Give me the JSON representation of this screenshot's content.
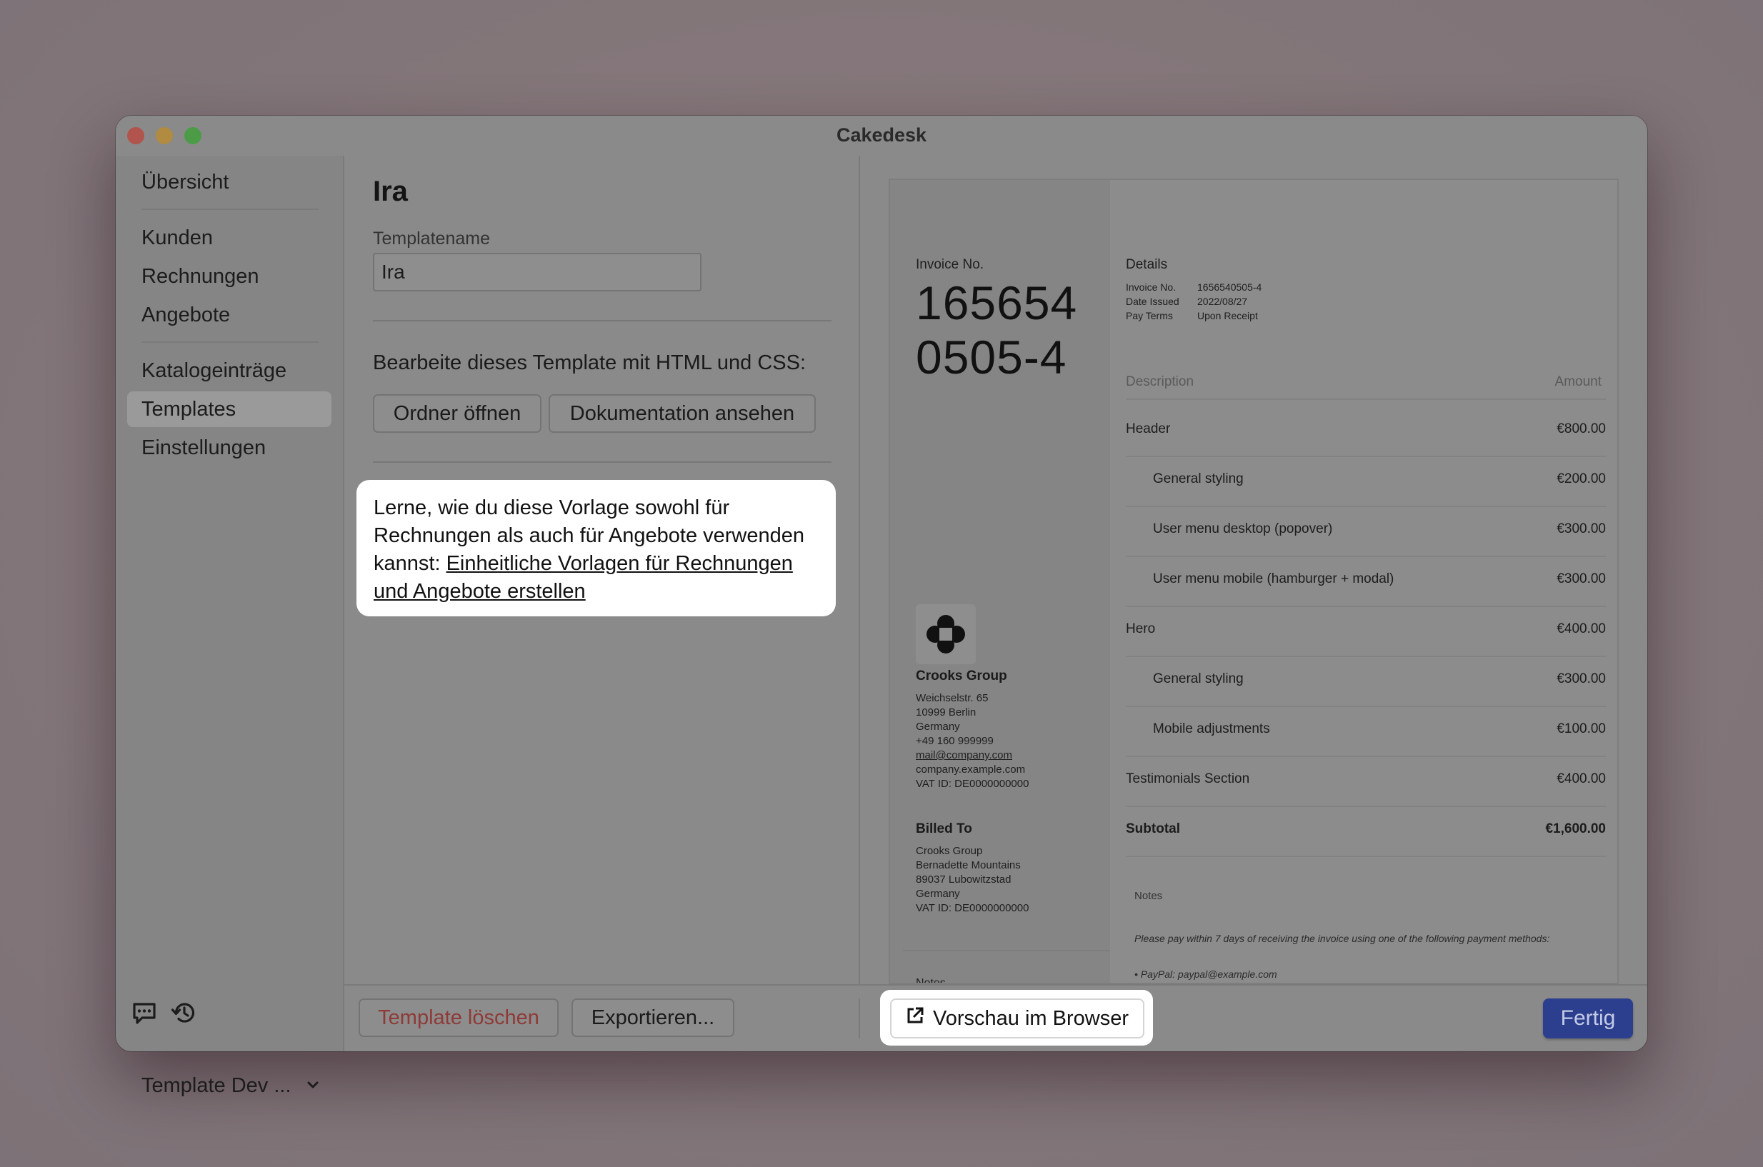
{
  "window": {
    "title": "Cakedesk"
  },
  "sidebar": {
    "items": [
      {
        "label": "Übersicht"
      },
      {
        "label": "Kunden"
      },
      {
        "label": "Rechnungen"
      },
      {
        "label": "Angebote"
      },
      {
        "label": "Katalogeinträge"
      },
      {
        "label": "Templates",
        "active": true
      },
      {
        "label": "Einstellungen"
      }
    ],
    "footer_label": "Template Dev ..."
  },
  "editor": {
    "heading": "Ira",
    "name_label": "Templatename",
    "name_value": "Ira",
    "edit_text": "Bearbeite dieses Template mit HTML und CSS:",
    "open_folder_label": "Ordner öffnen",
    "docs_label": "Dokumentation ansehen",
    "callout_text": "Lerne, wie du diese Vorlage sowohl für Rechnungen als auch für Angebote verwenden kannst: ",
    "callout_link": "Einheitliche Vorlagen für Rechnungen und Angebote erstellen"
  },
  "bottom": {
    "delete_label": "Template löschen",
    "export_label": "Exportieren...",
    "preview_label": "Vorschau im Browser",
    "done_label": "Fertig"
  },
  "invoice": {
    "no_label": "Invoice No.",
    "no_line1": "165654",
    "no_line2": "0505-4",
    "company": {
      "name": "Crooks Group",
      "street": "Weichselstr. 65",
      "city": "10999 Berlin",
      "country": "Germany",
      "phone": "+49 160 999999",
      "email": "mail@company.com",
      "web": "company.example.com",
      "vat": "VAT ID: DE0000000000"
    },
    "billed_to": {
      "label": "Billed To",
      "name": "Crooks Group",
      "street": "Bernadette Mountains",
      "city": "89037 Lubowitzstad",
      "country": "Germany",
      "vat": "VAT ID: DE0000000000"
    },
    "left_notes_label": "Notes",
    "details": {
      "label": "Details",
      "invoice_no_key": "Invoice No.",
      "invoice_no_val": "1656540505-4",
      "date_key": "Date Issued",
      "date_val": "2022/08/27",
      "terms_key": "Pay Terms",
      "terms_val": "Upon Receipt"
    },
    "col_desc": "Description",
    "col_amount": "Amount",
    "lines": [
      {
        "desc": "Header",
        "amount": "€800.00",
        "indent": false
      },
      {
        "desc": "General styling",
        "amount": "€200.00",
        "indent": true
      },
      {
        "desc": "User menu desktop (popover)",
        "amount": "€300.00",
        "indent": true
      },
      {
        "desc": "User menu mobile (hamburger + modal)",
        "amount": "€300.00",
        "indent": true
      },
      {
        "desc": "Hero",
        "amount": "€400.00",
        "indent": false
      },
      {
        "desc": "General styling",
        "amount": "€300.00",
        "indent": true
      },
      {
        "desc": "Mobile adjustments",
        "amount": "€100.00",
        "indent": true
      },
      {
        "desc": "Testimonials Section",
        "amount": "€400.00",
        "indent": false
      }
    ],
    "subtotal_label": "Subtotal",
    "subtotal_value": "€1,600.00",
    "notes_label": "Notes",
    "notes_text": "Please pay within 7 days of receiving the invoice using one of the following payment methods:",
    "notes_bullet": "PayPal: paypal@example.com"
  }
}
